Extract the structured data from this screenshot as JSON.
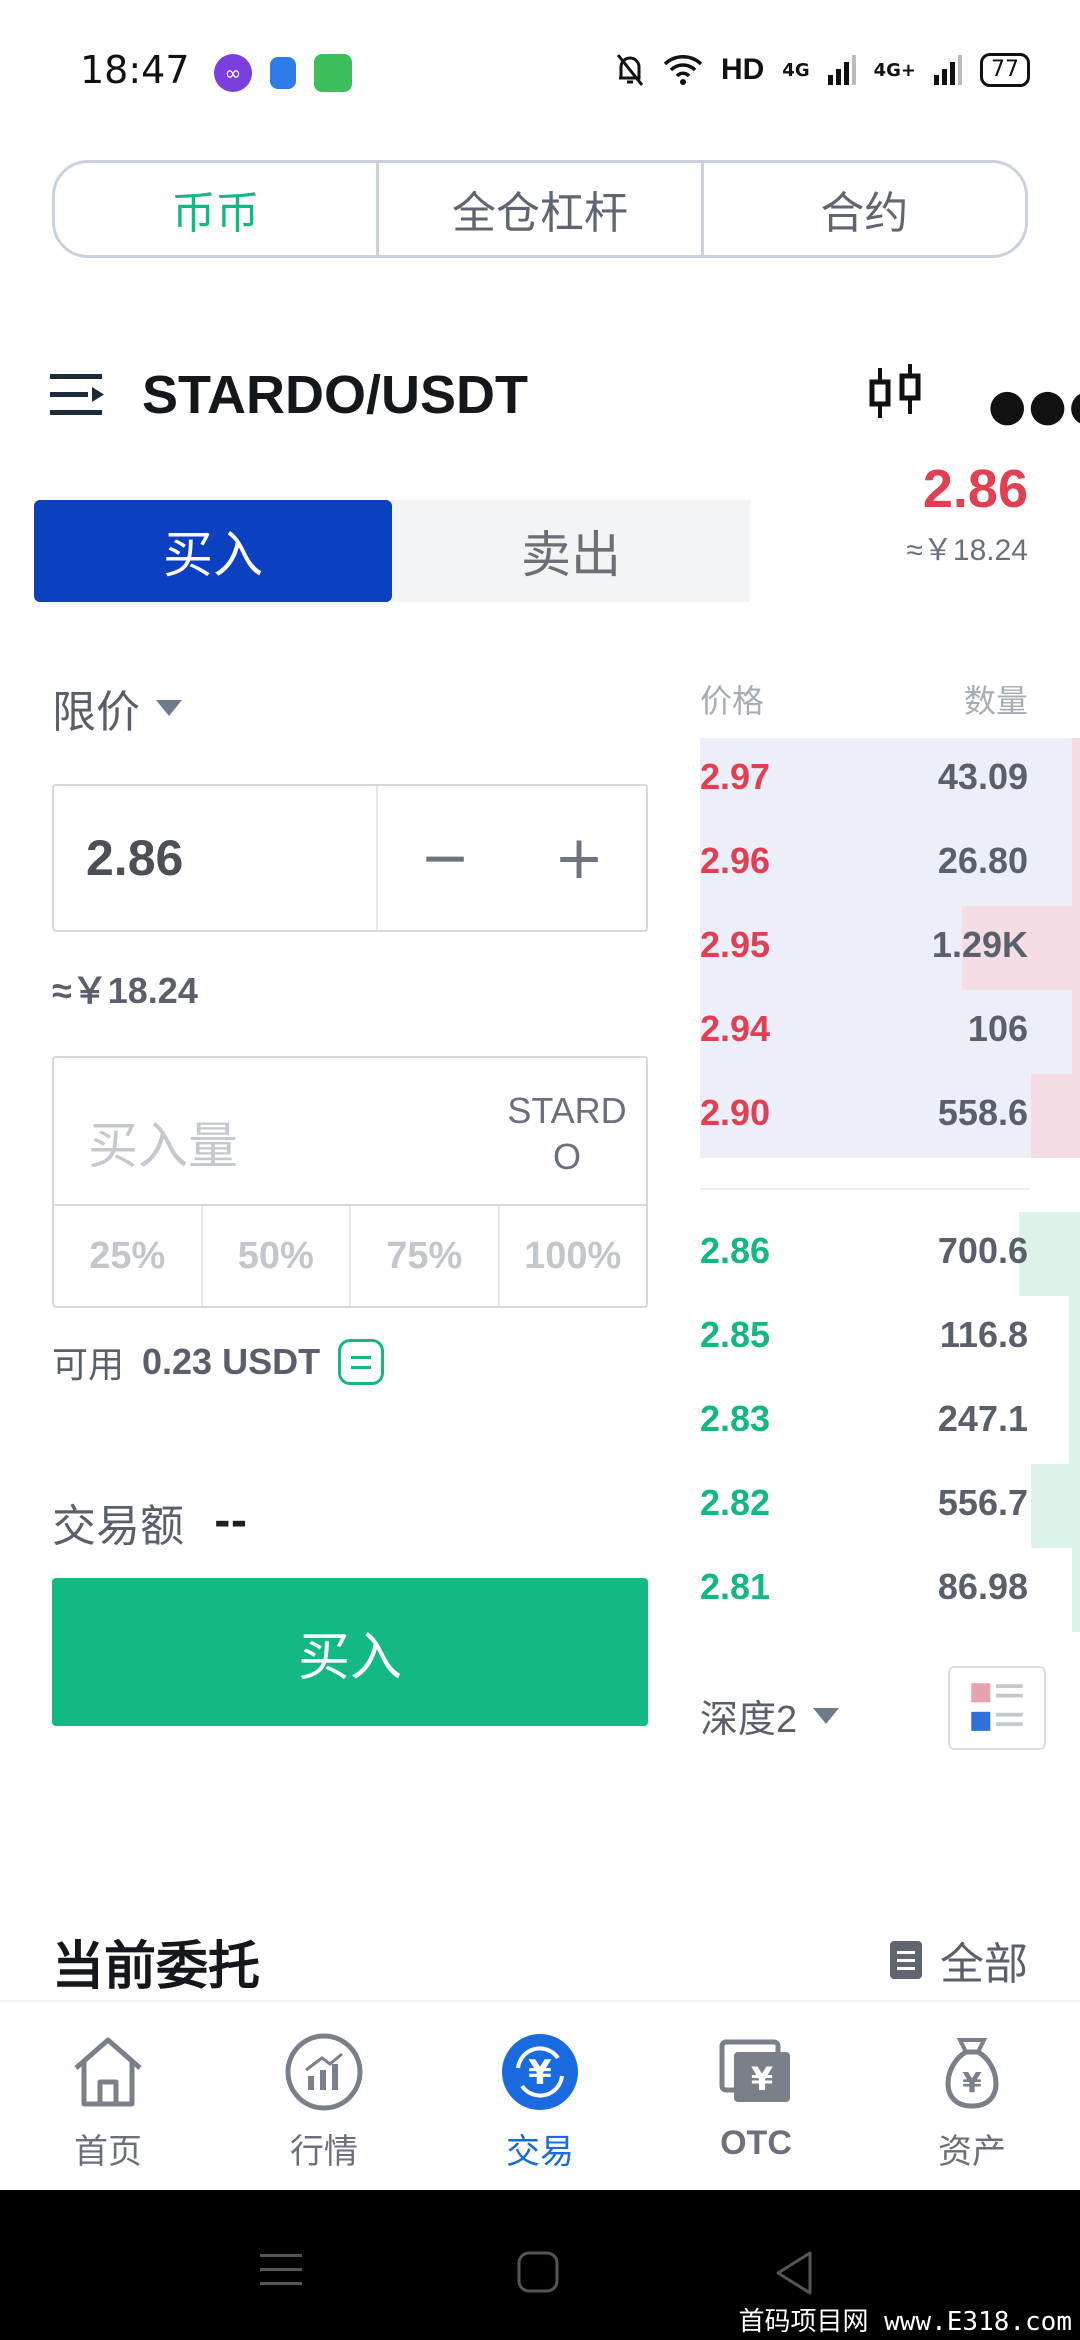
{
  "status_bar": {
    "time": "18:47",
    "network": "HD",
    "signal_1": "4G",
    "signal_2": "4G+",
    "battery": "77"
  },
  "mode_tabs": [
    {
      "label": "币币",
      "active": true
    },
    {
      "label": "全仓杠杆",
      "active": false
    },
    {
      "label": "合约",
      "active": false
    }
  ],
  "pair": {
    "name": "STARDO/USDT",
    "last_price": "2.86",
    "last_price_cny": "≈￥18.24"
  },
  "side_toggle": {
    "buy_label": "买入",
    "sell_label": "卖出"
  },
  "form": {
    "order_type": "限价",
    "price_value": "2.86",
    "price_minus": "−",
    "price_plus": "+",
    "price_cny": "≈￥18.24",
    "amount_placeholder": "买入量",
    "amount_unit": "STARDO",
    "percent_options": [
      "25%",
      "50%",
      "75%",
      "100%"
    ],
    "available_label": "可用",
    "available_value": "0.23 USDT",
    "trade_amount_label": "交易额",
    "trade_amount_value": "--",
    "submit_label": "买入"
  },
  "order_book": {
    "price_header": "价格",
    "qty_header": "数量",
    "asks": [
      {
        "price": "2.97",
        "qty": "43.09",
        "depth": 0.02
      },
      {
        "price": "2.96",
        "qty": "26.80",
        "depth": 0.02
      },
      {
        "price": "2.95",
        "qty": "1.29K",
        "depth": 0.31
      },
      {
        "price": "2.94",
        "qty": "106",
        "depth": 0.02
      },
      {
        "price": "2.90",
        "qty": "558.6",
        "depth": 0.13
      }
    ],
    "bids": [
      {
        "price": "2.86",
        "qty": "700.6",
        "depth": 0.16
      },
      {
        "price": "2.85",
        "qty": "116.8",
        "depth": 0.03
      },
      {
        "price": "2.83",
        "qty": "247.1",
        "depth": 0.03
      },
      {
        "price": "2.82",
        "qty": "556.7",
        "depth": 0.13
      },
      {
        "price": "2.81",
        "qty": "86.98",
        "depth": 0.02
      }
    ],
    "depth_label": "深度2"
  },
  "orders": {
    "title": "当前委托",
    "all_label": "全部"
  },
  "bottom_nav": [
    {
      "label": "首页",
      "icon": "home-icon",
      "active": false
    },
    {
      "label": "行情",
      "icon": "market-chart-icon",
      "active": false
    },
    {
      "label": "交易",
      "icon": "trade-yuan-icon",
      "active": true
    },
    {
      "label": "OTC",
      "icon": "otc-yuan-icon",
      "active": false
    },
    {
      "label": "资产",
      "icon": "money-bag-icon",
      "active": false
    }
  ],
  "watermark": "首码项目网 www.E318.com",
  "colors": {
    "green": "#14b884",
    "red": "#e04052",
    "blue": "#0b40c0",
    "nav_active": "#1a6be0"
  }
}
